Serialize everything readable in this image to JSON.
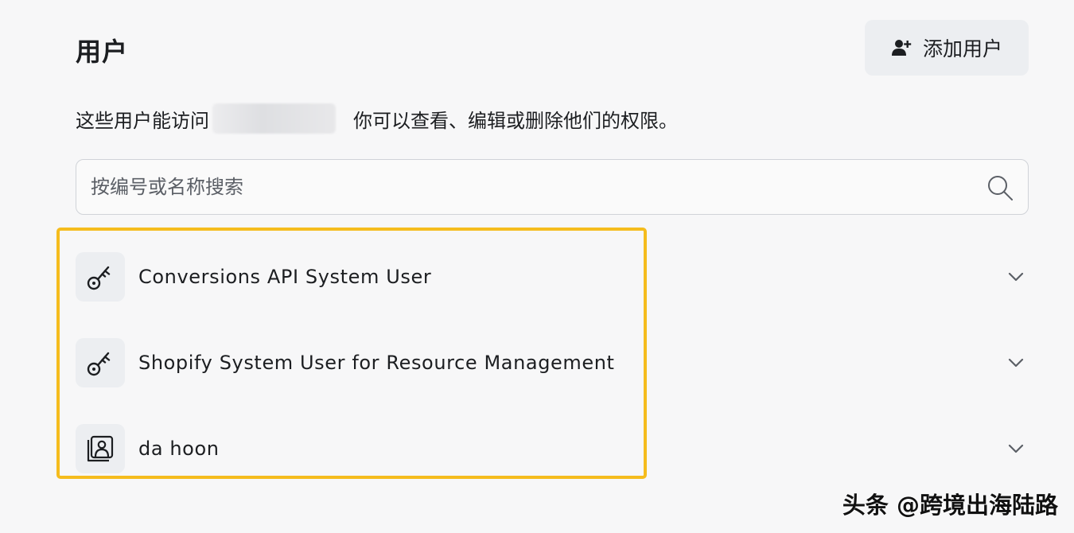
{
  "page": {
    "title": "用户",
    "add_user_label": "添加用户",
    "description_before": "这些用户能访问",
    "description_after": "你可以查看、编辑或删除他们的权限。",
    "search_placeholder": "按编号或名称搜索"
  },
  "users": [
    {
      "name": "Conversions API System User",
      "icon": "key-icon"
    },
    {
      "name": "Shopify System User for Resource Management",
      "icon": "key-icon"
    },
    {
      "name": "da hoon",
      "icon": "person-photo-icon"
    }
  ],
  "watermark": "头条 @跨境出海陆路",
  "colors": {
    "highlight": "#f5bc1d",
    "button_bg": "#eceef1",
    "border": "#d0d3d8"
  }
}
